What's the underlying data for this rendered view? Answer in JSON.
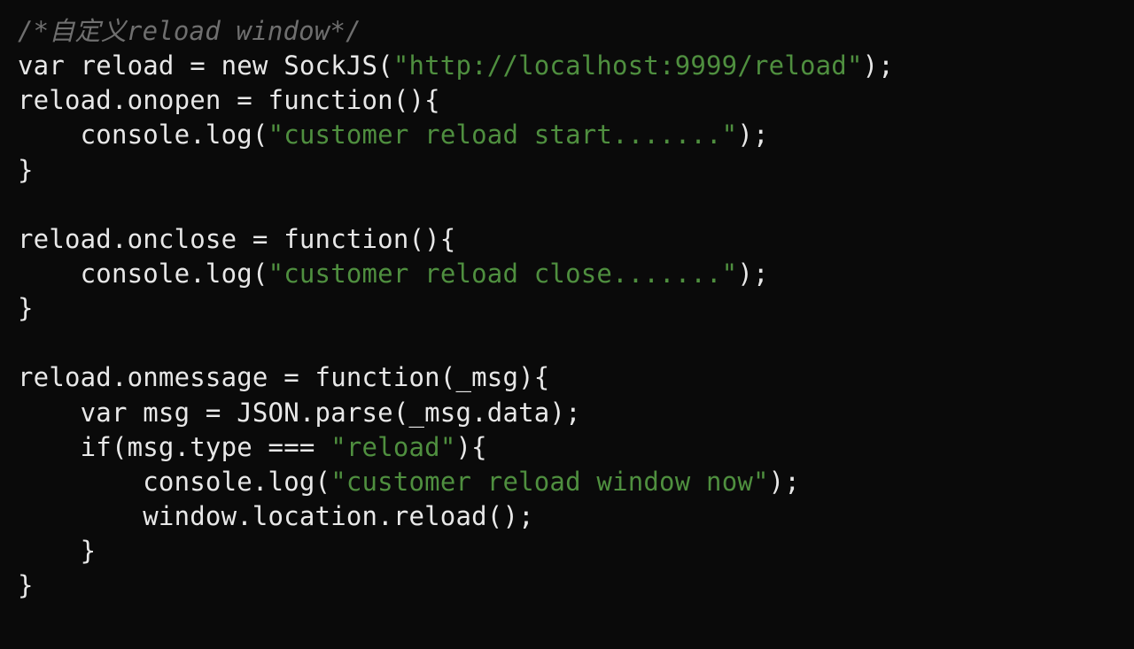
{
  "code": {
    "comment": "/*自定义reload window*/",
    "line2": {
      "pre": "var reload = new SockJS(",
      "str": "\"http://localhost:9999/reload\"",
      "post": ");"
    },
    "line3": "reload.onopen = function(){",
    "line4": {
      "pre": "    console.log(",
      "str": "\"customer reload start.......\"",
      "post": ");"
    },
    "line5": "}",
    "blank1": "",
    "line7": "reload.onclose = function(){",
    "line8": {
      "pre": "    console.log(",
      "str": "\"customer reload close.......\"",
      "post": ");"
    },
    "line9": "}",
    "blank2": "",
    "line11": "reload.onmessage = function(_msg){",
    "line12": "    var msg = JSON.parse(_msg.data);",
    "line13": {
      "pre": "    if(msg.type === ",
      "str": "\"reload\"",
      "post": "){"
    },
    "line14": {
      "pre": "        console.log(",
      "str": "\"customer reload window now\"",
      "post": ");"
    },
    "line15": "        window.location.reload();",
    "line16": "    }",
    "line17": "}"
  }
}
